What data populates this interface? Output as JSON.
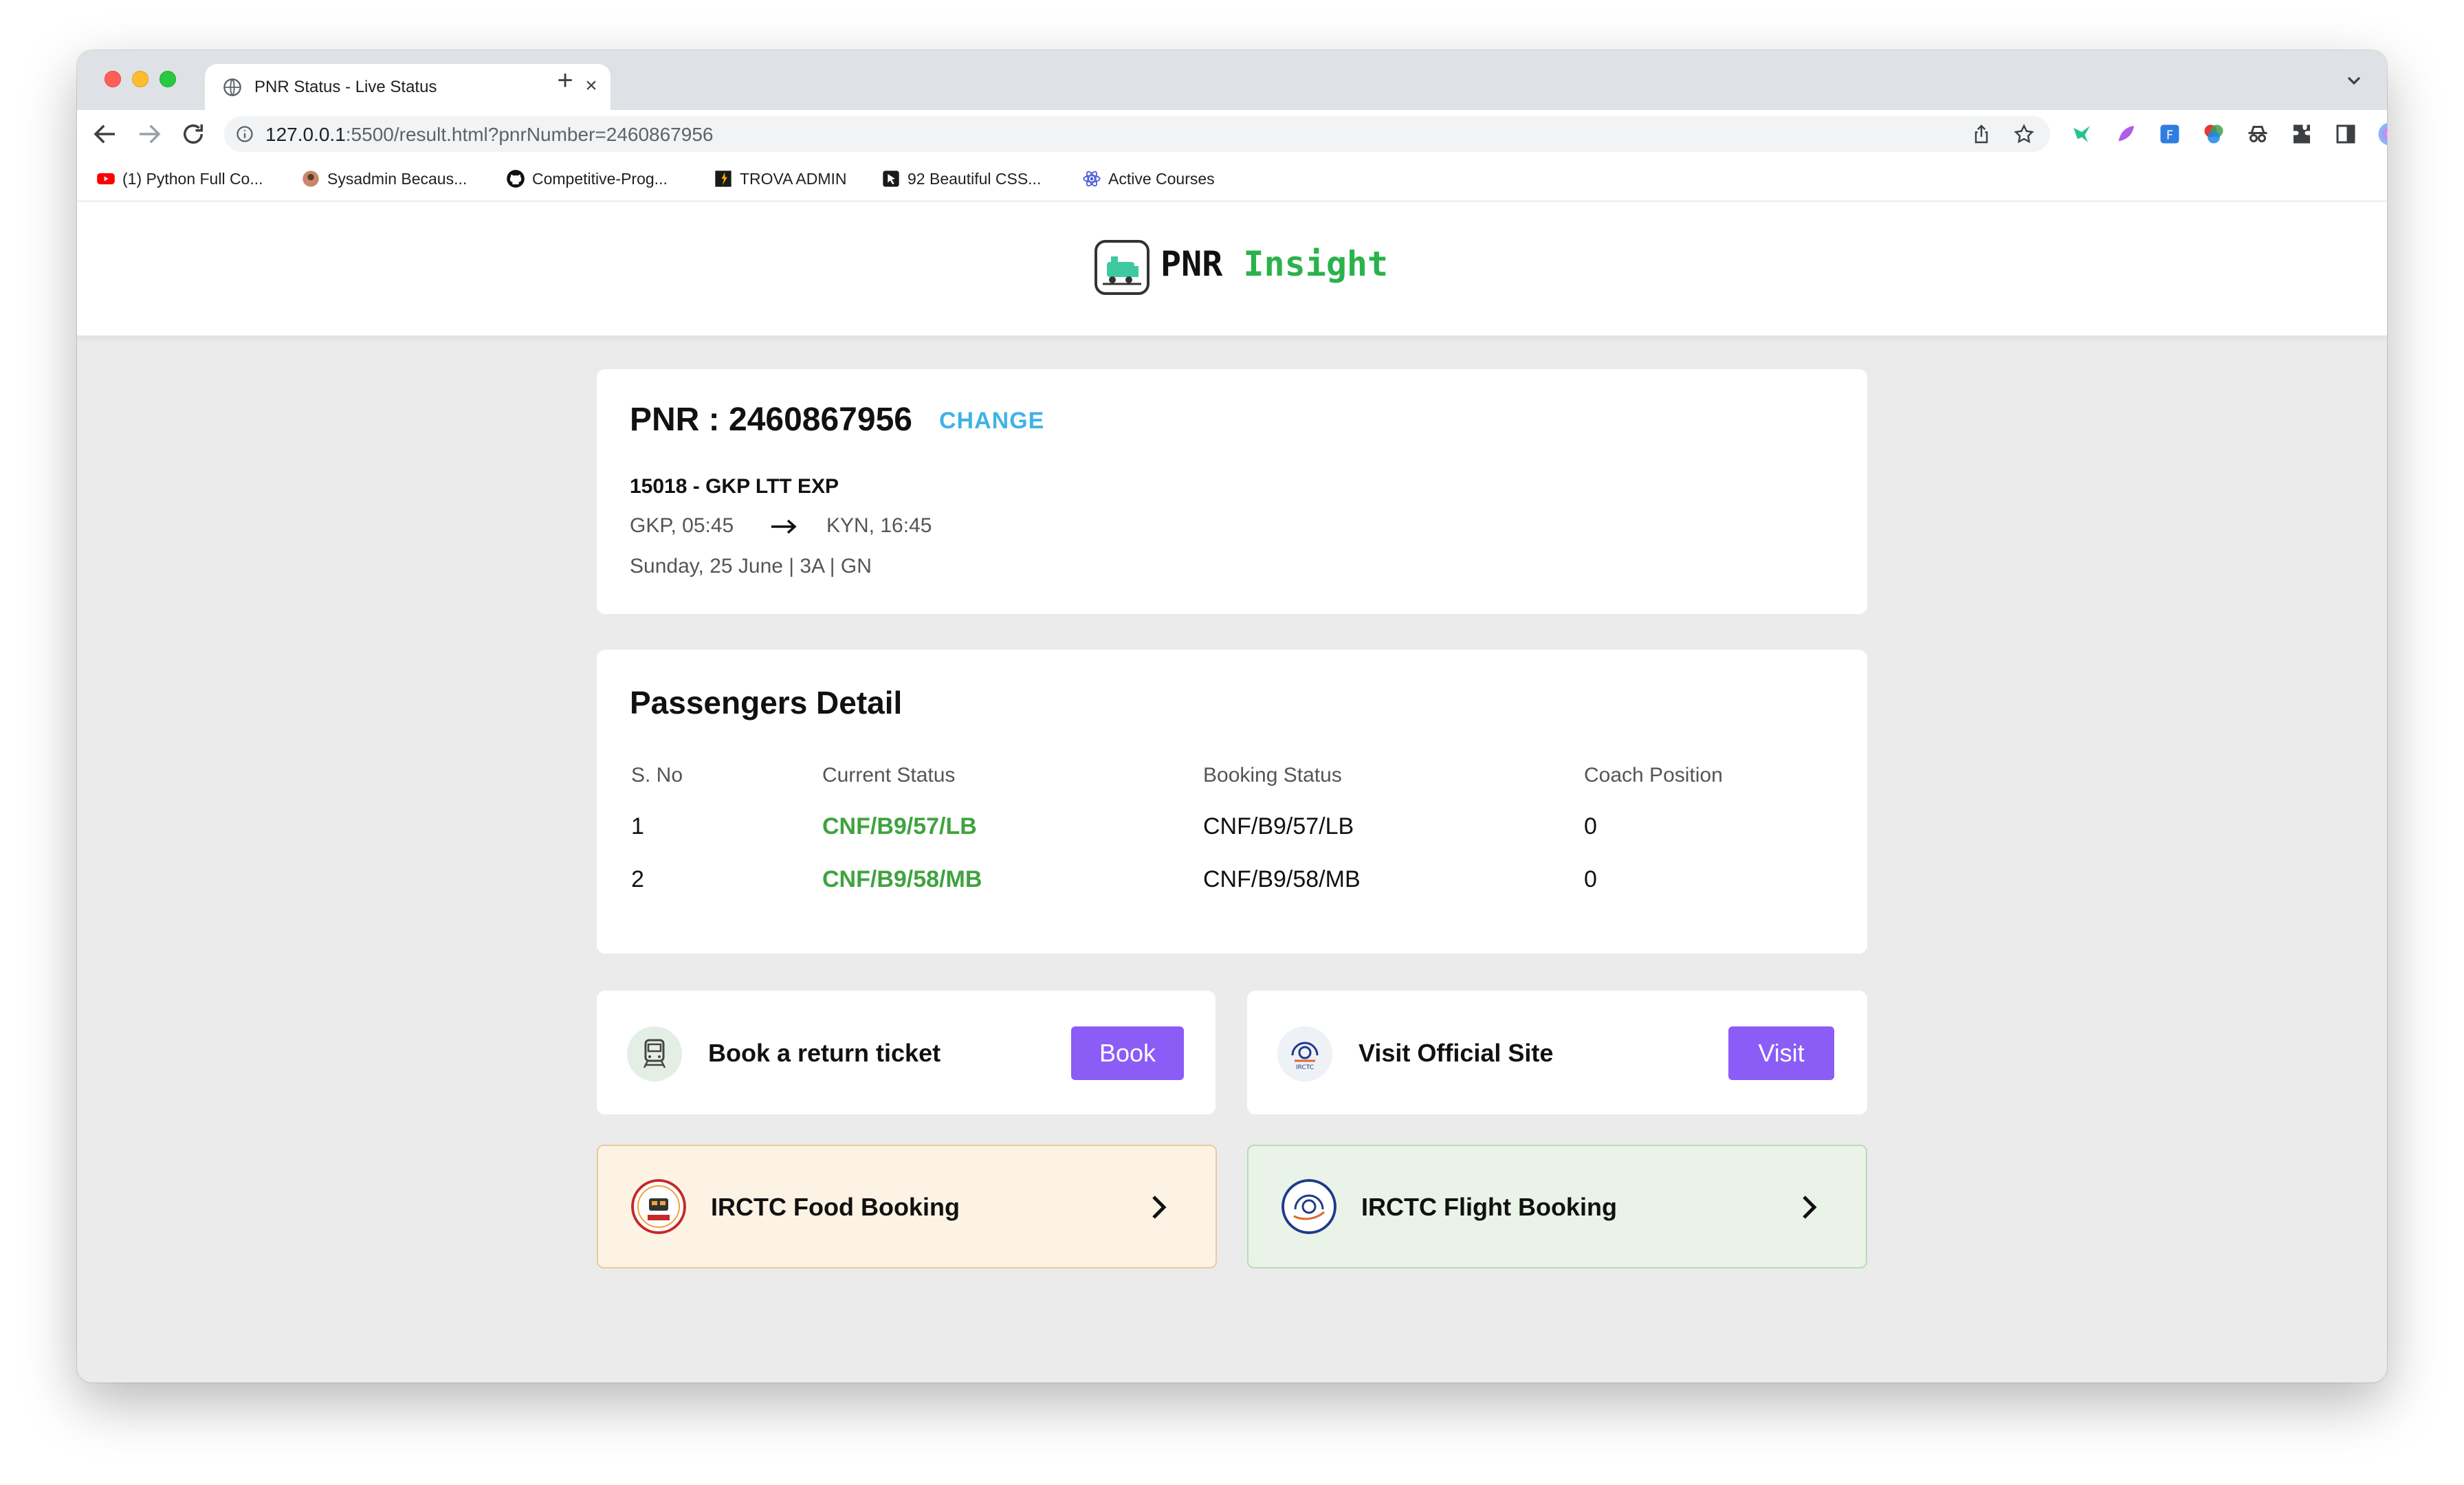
{
  "browser": {
    "tab_title": "PNR Status - Live Status",
    "url_host": "127.0.0.1",
    "url_rest": ":5500/result.html?pnrNumber=2460867956",
    "bookmarks": [
      {
        "label": "(1) Python Full Co..."
      },
      {
        "label": "Sysadmin Becaus..."
      },
      {
        "label": "Competitive-Prog..."
      },
      {
        "label": "TROVA ADMIN"
      },
      {
        "label": "92 Beautiful CSS..."
      },
      {
        "label": "Active Courses"
      }
    ]
  },
  "site": {
    "logo_pnr": "PNR",
    "logo_insight": "Insight",
    "brand_green": "#2bb24c",
    "accent_purple": "#8b5cf6",
    "link_blue": "#3fb3e6"
  },
  "pnr": {
    "label": "PNR : 2460867956",
    "change": "CHANGE",
    "train": "15018 - GKP LTT EXP",
    "from": "GKP, 05:45",
    "to": "KYN, 16:45",
    "journey": "Sunday, 25 June | 3A | GN"
  },
  "passengers": {
    "title": "Passengers Detail",
    "headers": [
      "S. No",
      "Current Status",
      "Booking Status",
      "Coach Position"
    ],
    "rows": [
      {
        "sno": "1",
        "current": "CNF/B9/57/LB",
        "booking": "CNF/B9/57/LB",
        "coach": "0"
      },
      {
        "sno": "2",
        "current": "CNF/B9/58/MB",
        "booking": "CNF/B9/58/MB",
        "coach": "0"
      }
    ]
  },
  "actions": {
    "return_label": "Book a return ticket",
    "return_btn": "Book",
    "visit_label": "Visit Official Site",
    "visit_btn": "Visit"
  },
  "links": {
    "food": "IRCTC Food Booking",
    "flight": "IRCTC Flight Booking"
  }
}
